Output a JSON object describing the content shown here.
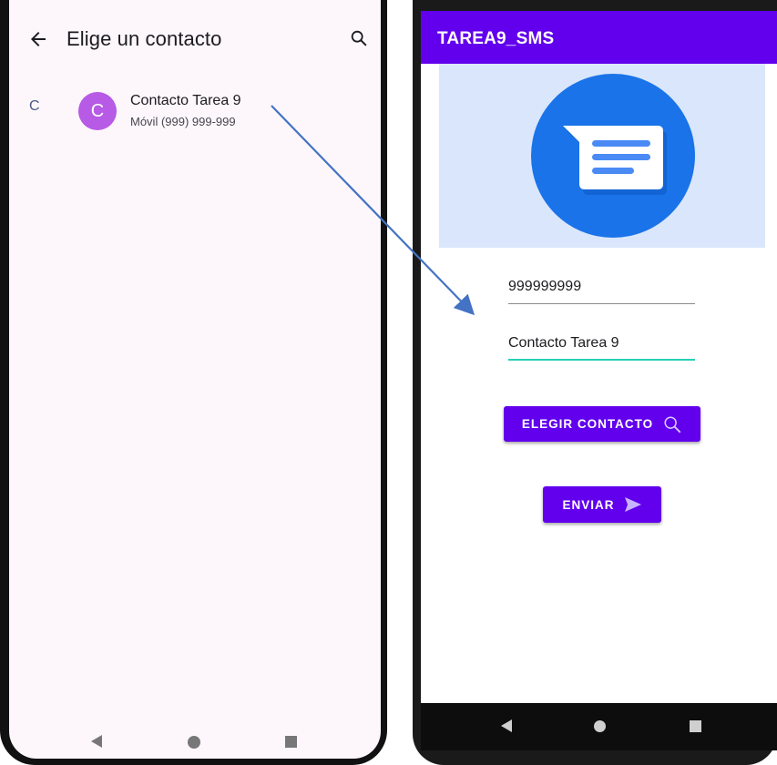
{
  "contact_picker": {
    "title": "Elige un contacto",
    "back_icon": "arrow-back-icon",
    "search_icon": "search-icon",
    "section_letter": "C",
    "contact": {
      "avatar_letter": "C",
      "name": "Contacto Tarea 9",
      "phone": "Móvil (999) 999-999",
      "avatar_color": "#b75ae6"
    }
  },
  "sms_app": {
    "title": "TAREA9_SMS",
    "primary_color": "#6200ee",
    "image_icon": "messages-app-icon",
    "phone_field": {
      "value": "999999999"
    },
    "name_field": {
      "value": "Contacto Tarea 9",
      "accent_color": "#25d0b5"
    },
    "choose_contact_button": {
      "label": "ELEGIR CONTACTO",
      "icon": "search-icon"
    },
    "send_button": {
      "label": "ENVIAR",
      "icon": "send-icon"
    }
  },
  "annotation": {
    "arrow_color": "#4472c4",
    "icon": "arrow-annotation-icon"
  },
  "navigation_bar": {
    "icons": [
      "nav-back-icon",
      "nav-home-icon",
      "nav-recents-icon"
    ]
  }
}
